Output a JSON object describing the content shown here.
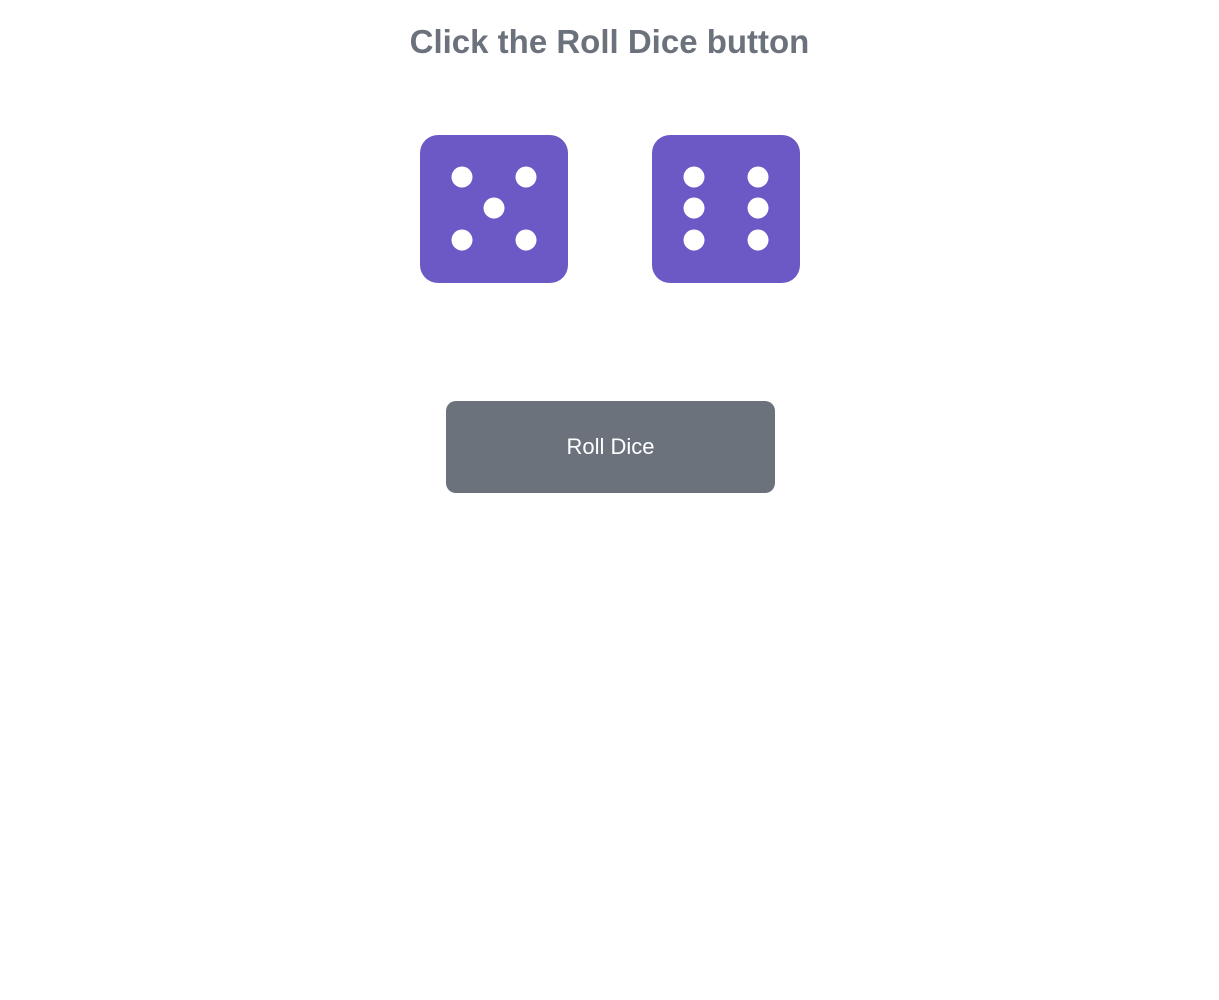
{
  "header": {
    "title": "Click the Roll Dice button"
  },
  "dice": [
    {
      "name": "die-five-icon",
      "value": 5
    },
    {
      "name": "die-six-icon",
      "value": 6
    }
  ],
  "controls": {
    "roll_label": "Roll Dice"
  },
  "colors": {
    "die_face": "#6c59c6",
    "pip": "#ffffff",
    "button": "#6b727c",
    "title": "#6b727c"
  }
}
